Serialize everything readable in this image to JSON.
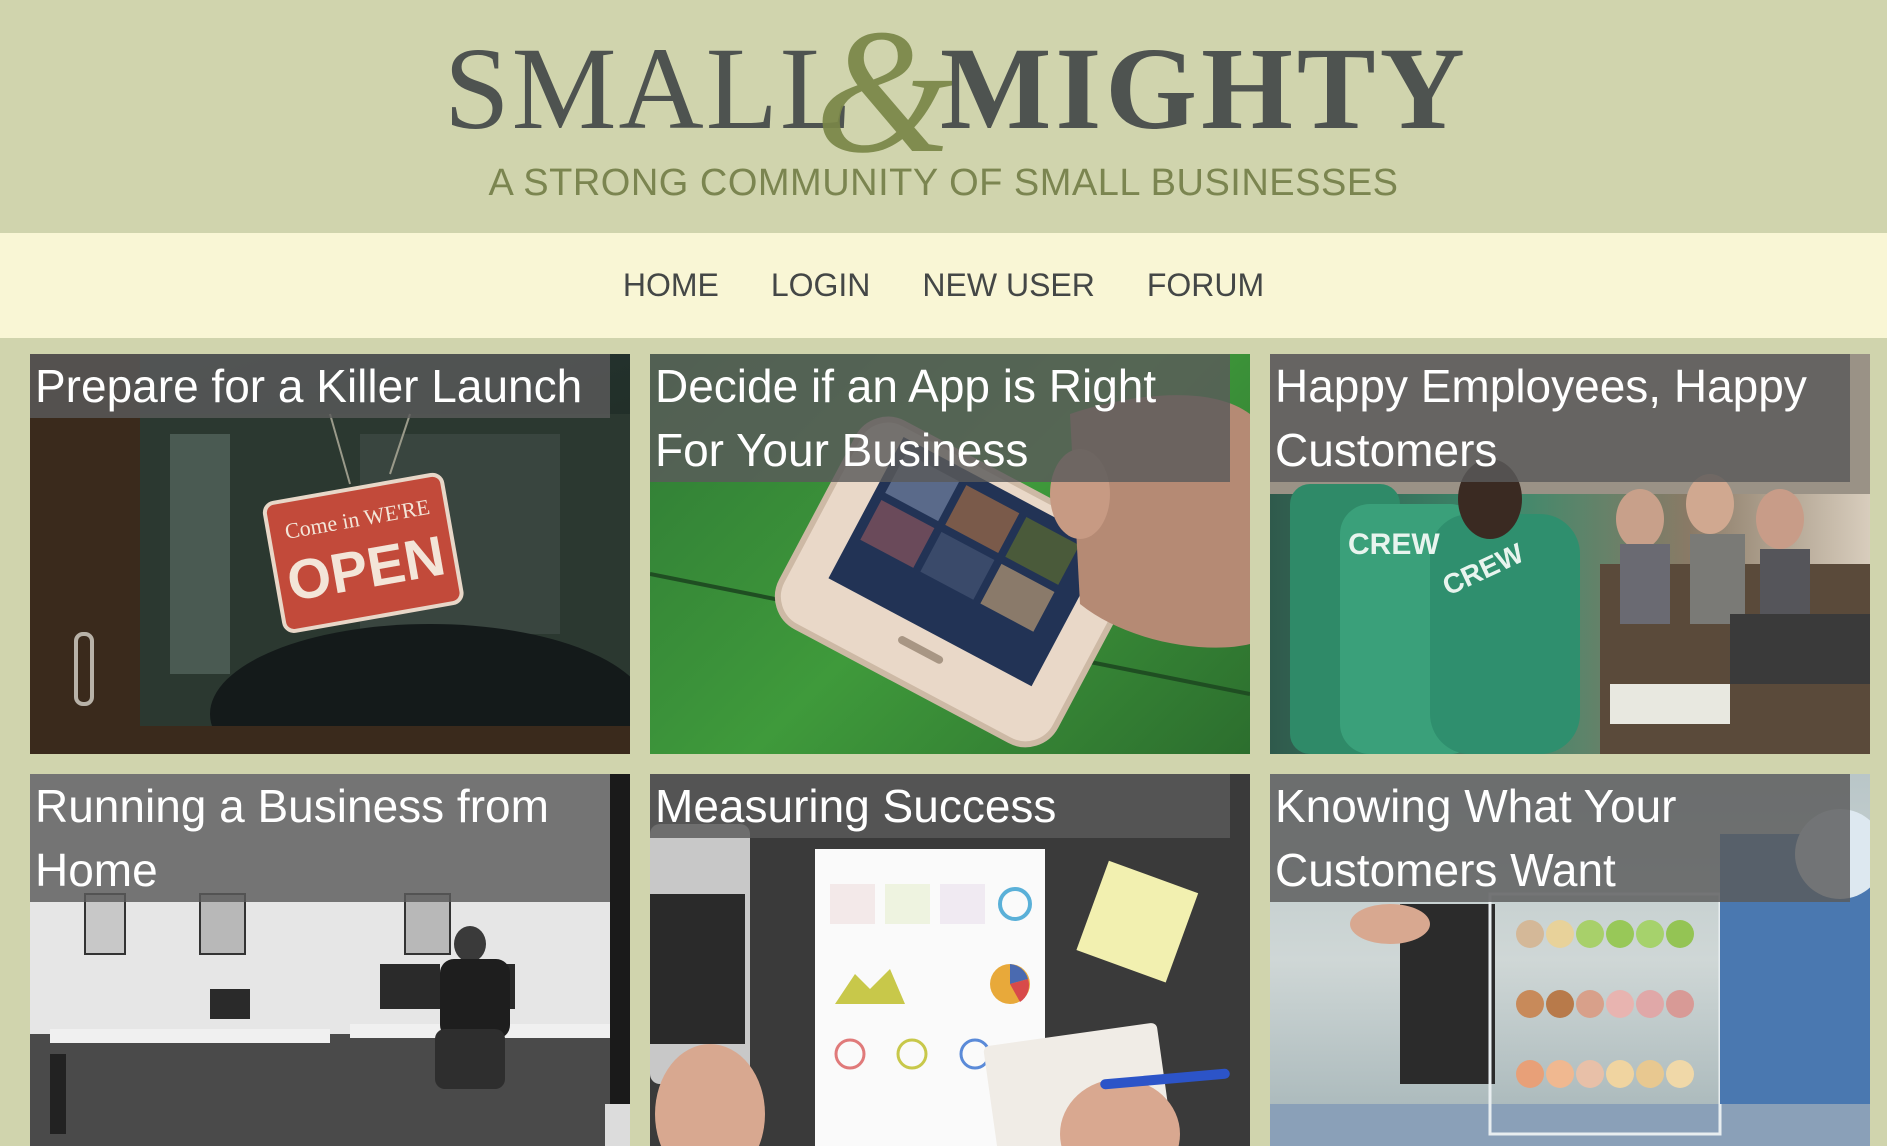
{
  "header": {
    "logo_left": "SMALL",
    "logo_amp": "&",
    "logo_right": "MIGHTY",
    "tagline": "A STRONG COMMUNITY OF SMALL BUSINESSES"
  },
  "nav": {
    "items": [
      {
        "label": "HOME"
      },
      {
        "label": "LOGIN"
      },
      {
        "label": "NEW USER"
      },
      {
        "label": "FORUM"
      }
    ]
  },
  "cards": [
    {
      "title": "Prepare for a Killer Launch"
    },
    {
      "title": "Decide if an App is Right For Your Business"
    },
    {
      "title": "Happy Employees, Happy Customers"
    },
    {
      "title": "Running a Business from Home"
    },
    {
      "title": "Measuring Success"
    },
    {
      "title": "Knowing What Your Customers Want"
    }
  ],
  "photos": {
    "launch_sign_top": "Come in WE'RE",
    "launch_sign_main": "OPEN",
    "crew_shirt_1": "CREW",
    "crew_shirt_2": "CREW"
  },
  "colors": {
    "header_bg": "#d0d4ad",
    "nav_bg": "#f9f6d5",
    "logo_text": "#4e5350",
    "logo_amp": "#7a8648",
    "tagline": "#7b8550"
  }
}
